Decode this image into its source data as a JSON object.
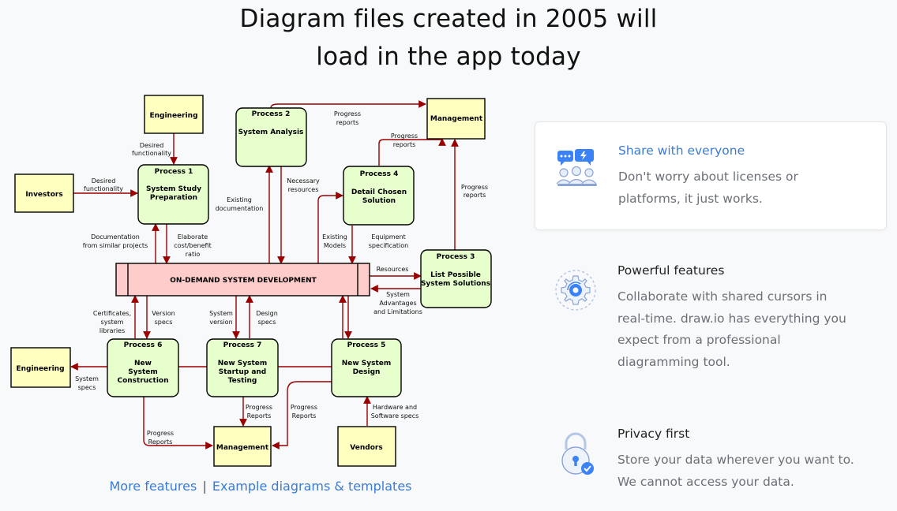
{
  "headline": {
    "line1": "Diagram files created in 2005 will",
    "line2": "load in the app today"
  },
  "diagram": {
    "center_bar": "ON-DEMAND SYSTEM DEVELOPMENT",
    "boxes": {
      "engineering_top": "Engineering",
      "management_top": "Management",
      "investors": "Investors",
      "engineering_left": "Engineering",
      "management_bottom": "Management",
      "vendors": "Vendors"
    },
    "processes": {
      "p1": {
        "title": "Process 1",
        "lines": [
          "System Study",
          "Preparation"
        ]
      },
      "p2": {
        "title": "Process 2",
        "lines": [
          "System Analysis"
        ]
      },
      "p3": {
        "title": "Process 3",
        "lines": [
          "List Possible",
          "System Solutions"
        ]
      },
      "p4": {
        "title": "Process 4",
        "lines": [
          "Detail Chosen",
          "Solution"
        ]
      },
      "p5": {
        "title": "Process 5",
        "lines": [
          "New System",
          "Design"
        ]
      },
      "p6": {
        "title": "Process 6",
        "lines": [
          "New",
          "System",
          "Construction"
        ]
      },
      "p7": {
        "title": "Process 7",
        "lines": [
          "New System",
          "Startup and",
          "Testing"
        ]
      }
    },
    "flow_labels": {
      "desired_functionality_top": [
        "Desired",
        "functionality"
      ],
      "desired_functionality_left": [
        "Desired",
        "functionality"
      ],
      "progress_reports_p2": [
        "Progress",
        "reports"
      ],
      "progress_reports_p4": [
        "Progress",
        "reports"
      ],
      "progress_reports_p3": [
        "Progress",
        "reports"
      ],
      "existing_documentation": [
        "Existing",
        "documentation"
      ],
      "necessary_resources": [
        "Necessary",
        "resources"
      ],
      "documentation_similar": [
        "Documentation",
        "from similar projects"
      ],
      "elaborate_cost": [
        "Elaborate",
        "cost/benefit",
        "ratio"
      ],
      "existing_models": [
        "Existing",
        "Models"
      ],
      "equipment_spec": [
        "Equipment",
        "specification"
      ],
      "resources": [
        "Resources"
      ],
      "system_advantages": [
        "System",
        "Advantages",
        "and Limitations"
      ],
      "certificates": [
        "Certificates,",
        "system",
        "libraries"
      ],
      "version_specs": [
        "Version",
        "specs"
      ],
      "system_version": [
        "System",
        "version"
      ],
      "design_specs": [
        "Design",
        "specs"
      ],
      "system_specs": [
        "System",
        "specs"
      ],
      "progress_reports_p6": [
        "Progress",
        "Reports"
      ],
      "progress_reports_p7": [
        "Progress",
        "Reports"
      ],
      "progress_reports_p5": [
        "Progress",
        "Reports"
      ],
      "hardware_software": [
        "Hardware and",
        "Software specs"
      ]
    },
    "colors": {
      "arrow": "#990000",
      "process_fill": "#e6ffcc",
      "entity_fill": "#ffffc0",
      "bar_fill": "#ffcccc"
    }
  },
  "links": {
    "more_features": "More features",
    "separator": "|",
    "examples": "Example diagrams & templates"
  },
  "features": [
    {
      "title": "Share with everyone",
      "icon": "share-people-icon",
      "desc": [
        "Don't worry about licenses or",
        "platforms, it just works."
      ]
    },
    {
      "title": "Powerful features",
      "icon": "gear-refresh-icon",
      "desc": [
        "Collaborate with shared cursors in",
        "real-time. draw.io has everything you",
        "expect from a professional",
        "diagramming tool."
      ]
    },
    {
      "title": "Privacy first",
      "icon": "lock-check-icon",
      "desc": [
        "Store your data wherever you want to.",
        "We cannot access your data."
      ]
    }
  ],
  "accent_color": "#3b7bd4"
}
